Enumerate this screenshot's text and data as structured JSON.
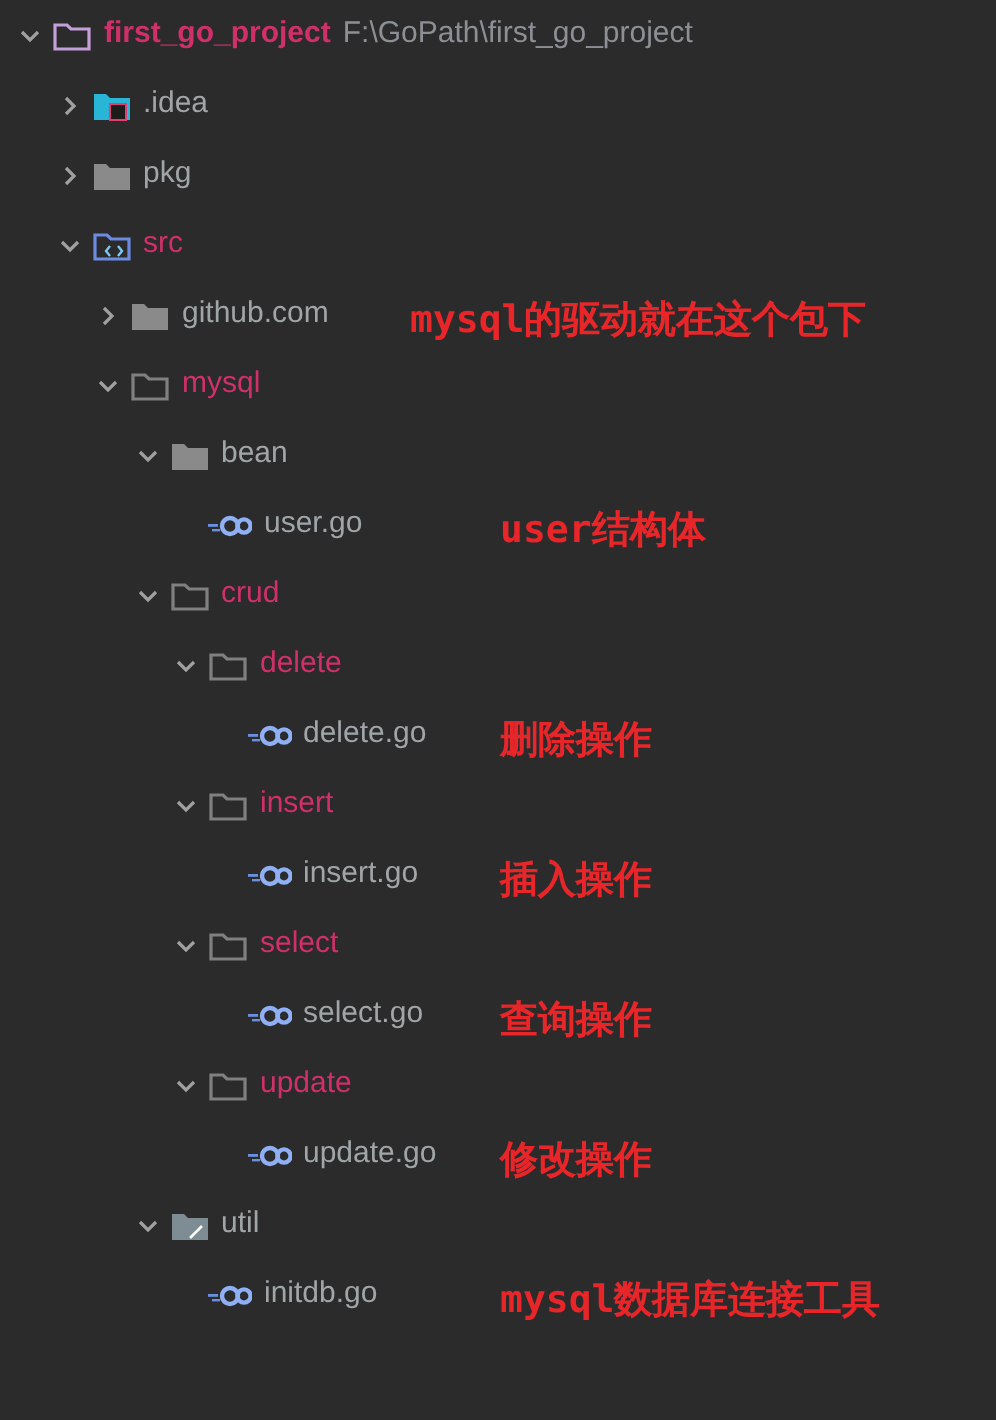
{
  "tree": [
    {
      "name": "first_go_project",
      "kind": "project",
      "path": "F:\\GoPath\\first_go_project",
      "expanded": true,
      "highlighted": true,
      "children": [
        {
          "name": ".idea",
          "kind": "idea",
          "expanded": false,
          "highlighted": false
        },
        {
          "name": "pkg",
          "kind": "folder",
          "expanded": false,
          "highlighted": false
        },
        {
          "name": "src",
          "kind": "source",
          "expanded": true,
          "highlighted": true,
          "children": [
            {
              "name": "github.com",
              "kind": "folder",
              "expanded": false,
              "highlighted": false,
              "note": "mysql的驱动就在这个包下"
            },
            {
              "name": "mysql",
              "kind": "folder",
              "expanded": true,
              "highlighted": true,
              "children": [
                {
                  "name": "bean",
                  "kind": "folder",
                  "expanded": true,
                  "highlighted": false,
                  "children": [
                    {
                      "name": "user.go",
                      "kind": "go",
                      "note": "user结构体"
                    }
                  ]
                },
                {
                  "name": "crud",
                  "kind": "folder",
                  "expanded": true,
                  "highlighted": true,
                  "children": [
                    {
                      "name": "delete",
                      "kind": "folder",
                      "expanded": true,
                      "highlighted": true,
                      "children": [
                        {
                          "name": "delete.go",
                          "kind": "go",
                          "note": "删除操作"
                        }
                      ]
                    },
                    {
                      "name": "insert",
                      "kind": "folder",
                      "expanded": true,
                      "highlighted": true,
                      "children": [
                        {
                          "name": "insert.go",
                          "kind": "go",
                          "note": "插入操作"
                        }
                      ]
                    },
                    {
                      "name": "select",
                      "kind": "folder",
                      "expanded": true,
                      "highlighted": true,
                      "children": [
                        {
                          "name": "select.go",
                          "kind": "go",
                          "note": "查询操作"
                        }
                      ]
                    },
                    {
                      "name": "update",
                      "kind": "folder",
                      "expanded": true,
                      "highlighted": true,
                      "children": [
                        {
                          "name": "update.go",
                          "kind": "go",
                          "note": "修改操作"
                        }
                      ]
                    }
                  ]
                },
                {
                  "name": "util",
                  "kind": "package",
                  "expanded": true,
                  "highlighted": false,
                  "children": [
                    {
                      "name": "initdb.go",
                      "kind": "go",
                      "note": "mysql数据库连接工具"
                    }
                  ]
                }
              ]
            }
          ]
        }
      ]
    }
  ]
}
